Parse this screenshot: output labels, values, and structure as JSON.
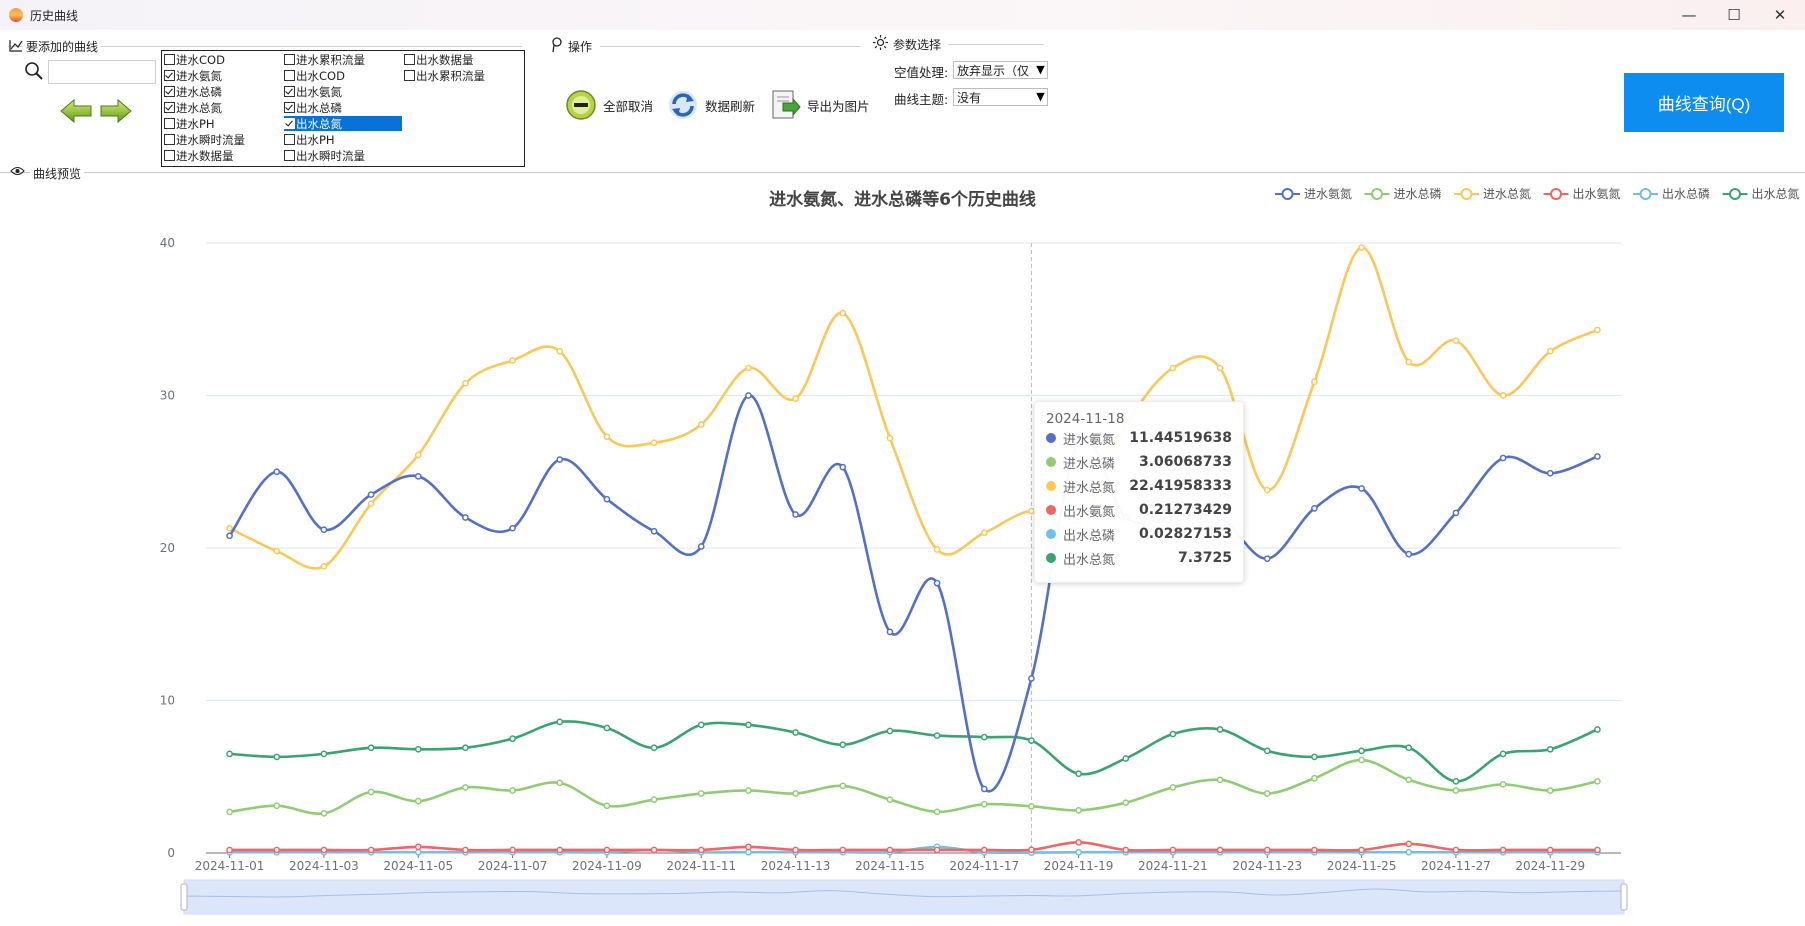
{
  "window": {
    "title": "历史曲线",
    "minimize": "—",
    "maximize": "☐",
    "close": "✕"
  },
  "sections": {
    "curves": "要添加的曲线",
    "ops": "操作",
    "params": "参数选择",
    "preview": "曲线预览"
  },
  "checkboxes": [
    {
      "label": "进水COD",
      "checked": false,
      "col": 0,
      "row": 0
    },
    {
      "label": "进水累积流量",
      "checked": false,
      "col": 1,
      "row": 0
    },
    {
      "label": "出水数据量",
      "checked": false,
      "col": 2,
      "row": 0
    },
    {
      "label": "进水氨氮",
      "checked": true,
      "col": 0,
      "row": 1
    },
    {
      "label": "出水COD",
      "checked": false,
      "col": 1,
      "row": 1
    },
    {
      "label": "出水累积流量",
      "checked": false,
      "col": 2,
      "row": 1
    },
    {
      "label": "进水总磷",
      "checked": true,
      "col": 0,
      "row": 2
    },
    {
      "label": "出水氨氮",
      "checked": true,
      "col": 1,
      "row": 2
    },
    {
      "label": "进水总氮",
      "checked": true,
      "col": 0,
      "row": 3
    },
    {
      "label": "出水总磷",
      "checked": true,
      "col": 1,
      "row": 3
    },
    {
      "label": "进水PH",
      "checked": false,
      "col": 0,
      "row": 4
    },
    {
      "label": "出水总氮",
      "checked": true,
      "col": 1,
      "row": 4,
      "selected": true
    },
    {
      "label": "进水瞬时流量",
      "checked": false,
      "col": 0,
      "row": 5
    },
    {
      "label": "出水PH",
      "checked": false,
      "col": 1,
      "row": 5
    },
    {
      "label": "进水数据量",
      "checked": false,
      "col": 0,
      "row": 6
    },
    {
      "label": "出水瞬时流量",
      "checked": false,
      "col": 1,
      "row": 6
    }
  ],
  "search": {
    "value": ""
  },
  "ops": {
    "cancel_all": "全部取消",
    "refresh": "数据刷新",
    "export": "导出为图片"
  },
  "params": {
    "null_label": "空值处理:",
    "null_value": "放弃显示（仅",
    "theme_label": "曲线主题:",
    "theme_value": "没有"
  },
  "query_button": "曲线查询(Q)",
  "colors": {
    "accent": "#0d8df0",
    "s1": "#5470c6",
    "s2": "#91cc75",
    "s3": "#fac858",
    "s4": "#ee6666",
    "s5": "#73c0de",
    "s6": "#3ba272"
  },
  "chart_data": {
    "type": "line",
    "title": "进水氨氮、进水总磷等6个历史曲线",
    "ylim": [
      0,
      40
    ],
    "yticks": [
      0,
      10,
      20,
      30,
      40
    ],
    "legend_position": "top-right",
    "grid": true,
    "x": [
      "2024-11-01",
      "2024-11-02",
      "2024-11-03",
      "2024-11-04",
      "2024-11-05",
      "2024-11-06",
      "2024-11-07",
      "2024-11-08",
      "2024-11-09",
      "2024-11-10",
      "2024-11-11",
      "2024-11-12",
      "2024-11-13",
      "2024-11-14",
      "2024-11-15",
      "2024-11-16",
      "2024-11-17",
      "2024-11-18",
      "2024-11-19",
      "2024-11-20",
      "2024-11-21",
      "2024-11-22",
      "2024-11-23",
      "2024-11-24",
      "2024-11-25",
      "2024-11-26",
      "2024-11-27",
      "2024-11-28",
      "2024-11-29",
      "2024-11-30"
    ],
    "xtick_labels": [
      "2024-11-01",
      "2024-11-03",
      "2024-11-05",
      "2024-11-07",
      "2024-11-09",
      "2024-11-11",
      "2024-11-13",
      "2024-11-15",
      "2024-11-17",
      "2024-11-19",
      "2024-11-21",
      "2024-11-23",
      "2024-11-25",
      "2024-11-27",
      "2024-11-29"
    ],
    "series": [
      {
        "name": "进水氨氮",
        "color": "#5470c6",
        "values": [
          20.8,
          25.0,
          21.2,
          23.5,
          24.7,
          22.0,
          21.3,
          25.8,
          23.2,
          21.1,
          20.1,
          30.0,
          22.2,
          25.3,
          14.5,
          17.7,
          4.2,
          11.44519638,
          27.0,
          22.0,
          22.0,
          22.0,
          19.3,
          22.6,
          23.9,
          19.6,
          22.3,
          25.9,
          24.9,
          26.0
        ]
      },
      {
        "name": "进水总磷",
        "color": "#91cc75",
        "values": [
          2.7,
          3.1,
          2.6,
          4.0,
          3.4,
          4.3,
          4.1,
          4.6,
          3.1,
          3.5,
          3.9,
          4.1,
          3.9,
          4.4,
          3.5,
          2.7,
          3.2,
          3.06068733,
          2.8,
          3.3,
          4.3,
          4.8,
          3.9,
          4.9,
          6.1,
          4.8,
          4.1,
          4.5,
          4.1,
          4.7
        ]
      },
      {
        "name": "进水总氮",
        "color": "#fac858",
        "values": [
          21.3,
          19.8,
          18.8,
          22.9,
          26.1,
          30.8,
          32.3,
          32.9,
          27.3,
          26.9,
          28.1,
          31.8,
          29.8,
          35.4,
          27.2,
          19.9,
          21.0,
          22.41958333,
          21.5,
          28.0,
          31.8,
          31.8,
          23.8,
          30.9,
          39.7,
          32.2,
          33.6,
          30.0,
          32.9,
          34.3
        ]
      },
      {
        "name": "出水氨氮",
        "color": "#ee6666",
        "values": [
          0.2,
          0.2,
          0.2,
          0.2,
          0.4,
          0.2,
          0.2,
          0.2,
          0.2,
          0.2,
          0.2,
          0.4,
          0.2,
          0.2,
          0.2,
          0.2,
          0.2,
          0.21273429,
          0.7,
          0.2,
          0.2,
          0.2,
          0.2,
          0.2,
          0.2,
          0.6,
          0.2,
          0.2,
          0.2,
          0.2
        ]
      },
      {
        "name": "出水总磷",
        "color": "#73c0de",
        "values": [
          0.05,
          0.05,
          0.05,
          0.05,
          0.05,
          0.05,
          0.05,
          0.05,
          0.05,
          0.2,
          0.05,
          0.05,
          0.05,
          0.05,
          0.05,
          0.4,
          0.05,
          0.02827153,
          0.05,
          0.05,
          0.05,
          0.05,
          0.05,
          0.05,
          0.05,
          0.05,
          0.05,
          0.05,
          0.05,
          0.05
        ]
      },
      {
        "name": "出水总氮",
        "color": "#3ba272",
        "values": [
          6.5,
          6.3,
          6.5,
          6.9,
          6.8,
          6.9,
          7.5,
          8.6,
          8.2,
          6.9,
          8.4,
          8.4,
          7.9,
          7.1,
          8.0,
          7.7,
          7.6,
          7.3725,
          5.2,
          6.2,
          7.8,
          8.1,
          6.7,
          6.3,
          6.7,
          6.9,
          4.7,
          6.5,
          6.8,
          8.1
        ]
      }
    ],
    "tooltip": {
      "date": "2024-11-18",
      "rows": [
        {
          "name": "进水氨氮",
          "value": "11.44519638",
          "color": "#5470c6"
        },
        {
          "name": "进水总磷",
          "value": "3.06068733",
          "color": "#91cc75"
        },
        {
          "name": "进水总氮",
          "value": "22.41958333",
          "color": "#fac858"
        },
        {
          "name": "出水氨氮",
          "value": "0.21273429",
          "color": "#ee6666"
        },
        {
          "name": "出水总磷",
          "value": "0.02827153",
          "color": "#73c0de"
        },
        {
          "name": "出水总氮",
          "value": "7.3725",
          "color": "#3ba272"
        }
      ]
    }
  }
}
